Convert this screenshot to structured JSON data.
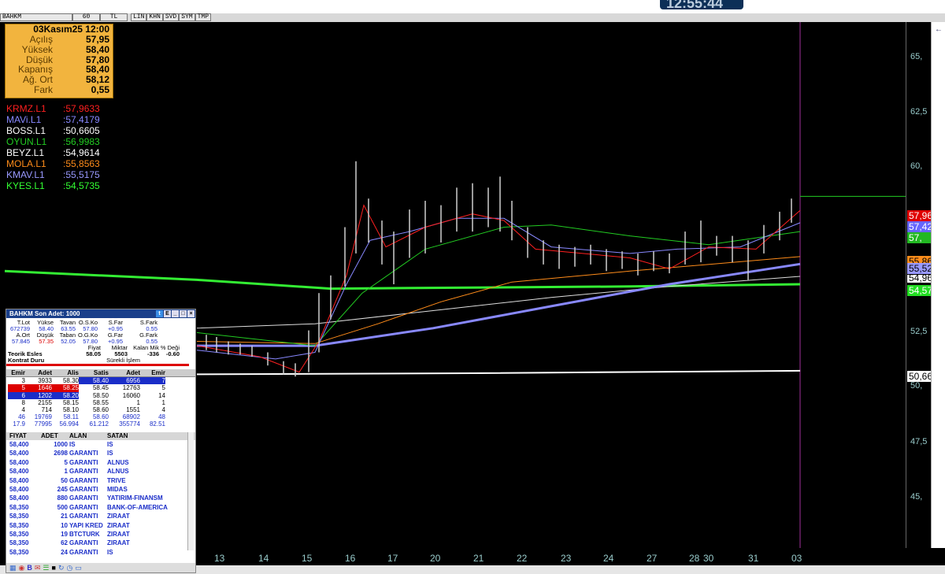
{
  "window": {
    "clock": "12:55:44"
  },
  "toolbar": {
    "symbol": "BAHKM",
    "period": "60",
    "currency": "TL",
    "buttons": [
      "LIN",
      "KHN",
      "SVD",
      "SYM",
      "TMP"
    ]
  },
  "info_box": {
    "date": "03Kasım25 12:00",
    "rows": [
      {
        "label": "Açılış",
        "value": "57,95"
      },
      {
        "label": "Yüksek",
        "value": "58,40"
      },
      {
        "label": "Düşük",
        "value": "57,80"
      },
      {
        "label": "Kapanış",
        "value": "58,40"
      },
      {
        "label": "Ağ. Ort",
        "value": "58,12"
      },
      {
        "label": "Fark",
        "value": "0,55"
      }
    ]
  },
  "indicators": [
    {
      "name": "KRMZ.L1",
      "value": ":57,9633",
      "color": "#ff2020"
    },
    {
      "name": "MAVi.L1",
      "value": ":57,4179",
      "color": "#8888ff"
    },
    {
      "name": "BOSS.L1",
      "value": ":50,6605",
      "color": "#ffffff"
    },
    {
      "name": "OYUN.L1",
      "value": ":56,9983",
      "color": "#22cc22"
    },
    {
      "name": "BEYZ.L1",
      "value": ":54,9614",
      "color": "#ffffff"
    },
    {
      "name": "MOLA.L1",
      "value": ":55,8563",
      "color": "#ff8c1a"
    },
    {
      "name": "KMAV.L1",
      "value": ":55,5175",
      "color": "#9999ff"
    },
    {
      "name": "KYES.L1",
      "value": ":54,5735",
      "color": "#33ff33"
    }
  ],
  "y_axis": {
    "ticks": [
      "65,",
      "62,5",
      "60,",
      "52,5",
      "50,",
      "47,5",
      "45,"
    ],
    "tags": [
      {
        "text": "57,96",
        "bg": "#e00000",
        "fg": "#ffffff"
      },
      {
        "text": "57,42",
        "bg": "#6666ff",
        "fg": "#ffffff"
      },
      {
        "text": "57,",
        "bg": "#22b822",
        "fg": "#ffffff"
      },
      {
        "text": "55,86",
        "bg": "#ff8c1a",
        "fg": "#000000"
      },
      {
        "text": "55,52",
        "bg": "#9999ff",
        "fg": "#000000"
      },
      {
        "text": "54,96",
        "bg": "#ffffff",
        "fg": "#000000"
      },
      {
        "text": "54,57",
        "bg": "#22dd22",
        "fg": "#ffffff"
      },
      {
        "text": "50,66",
        "bg": "#ffffff",
        "fg": "#000000"
      }
    ]
  },
  "x_axis": {
    "labels": [
      "13",
      "14",
      "15",
      "16",
      "17",
      "20",
      "21",
      "22",
      "23",
      "24",
      "27",
      "28",
      "30",
      "31",
      "03"
    ]
  },
  "colors": {
    "info_bg": "#f2b43e",
    "panel_title": "#1a3f8a",
    "sell_highlight": "#1a2dc8",
    "buy_highlight": "#d00000"
  },
  "depth_panel": {
    "title": "BAHKM   Son Adet: 1000",
    "stats_head1": [
      "T.Lot",
      "Yükse",
      "Tavan",
      "O.S.Ko",
      "S.Far",
      "S.Fark"
    ],
    "stats_val1": [
      "672739",
      "58.40",
      "63.55",
      "57.80",
      "+0.95",
      "0.55"
    ],
    "stats_head2": [
      "A.Ort",
      "Düşük",
      "Taban",
      "O.G.Ko",
      "G.Far",
      "G.Fark"
    ],
    "stats_val2": [
      "57.845",
      "57.35",
      "52.05",
      "57.80",
      "+0.95",
      "0.55"
    ],
    "teorik_head": [
      "",
      "Fiyat",
      "Miktar",
      "Kalan Mik",
      "% Deği"
    ],
    "teorik_row": [
      "Teorik Esles",
      "58.05",
      "5503",
      "-336",
      "-0.60"
    ],
    "kontrat_label": "Kontrat Duru",
    "kontrat_value": "Sürekli İşlem",
    "depth_head": [
      "Emir",
      "Adet",
      "Alis",
      "Satis",
      "Adet",
      "Emir",
      ""
    ],
    "depth_rows": [
      [
        "3",
        "3933",
        "58.30",
        "58.40",
        "6956",
        "7"
      ],
      [
        "5",
        "1646",
        "58.25",
        "58.45",
        "12763",
        "5"
      ],
      [
        "6",
        "1202",
        "58.20",
        "58.50",
        "16060",
        "14"
      ],
      [
        "8",
        "2155",
        "58.15",
        "58.55",
        "1",
        "1"
      ],
      [
        "4",
        "714",
        "58.10",
        "58.60",
        "1551",
        "4"
      ],
      [
        "46",
        "19769",
        "58.11",
        "58.60",
        "68902",
        "48"
      ],
      [
        "17.9",
        "77995",
        "56.994",
        "61.212",
        "355774",
        "82.51"
      ]
    ],
    "trades_head": [
      "FIYAT",
      "ADET",
      "ALAN",
      "SATAN"
    ],
    "trades": [
      [
        "58,400",
        "1000",
        "IS",
        "IS"
      ],
      [
        "58,400",
        "2698",
        "GARANTI",
        "IS"
      ],
      [
        "58,400",
        "5",
        "GARANTI",
        "ALNUS"
      ],
      [
        "58,400",
        "1",
        "GARANTI",
        "ALNUS"
      ],
      [
        "58,400",
        "50",
        "GARANTI",
        "TRIVE"
      ],
      [
        "58,400",
        "245",
        "GARANTI",
        "MIDAS"
      ],
      [
        "58,400",
        "880",
        "GARANTI",
        "YATIRIM-FINANSM"
      ],
      [
        "58,350",
        "500",
        "GARANTI",
        "BANK-OF-AMERICA"
      ],
      [
        "58,350",
        "21",
        "GARANTI",
        "ZIRAAT"
      ],
      [
        "58,350",
        "10",
        "YAPI KRED",
        "ZIRAAT"
      ],
      [
        "58,350",
        "19",
        "BTCTURK",
        "ZIRAAT"
      ],
      [
        "58,350",
        "62",
        "GARANTI",
        "ZIRAAT"
      ],
      [
        "58,350",
        "24",
        "GARANTI",
        "IS"
      ]
    ]
  }
}
